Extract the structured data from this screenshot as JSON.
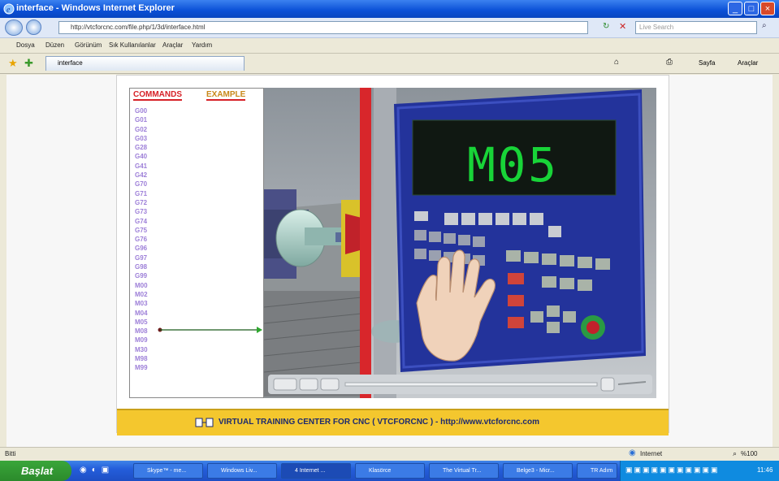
{
  "window": {
    "title": "interface - Windows Internet Explorer"
  },
  "address": {
    "url": "http://vtcforcnc.com/file.php/1/3d/interface.html",
    "search_placeholder": "Live Search"
  },
  "menu": [
    "Dosya",
    "Düzen",
    "Görünüm",
    "Sık Kullanılanlar",
    "Araçlar",
    "Yardım"
  ],
  "tab": {
    "label": "interface"
  },
  "toolbar_right": {
    "page_label": "Sayfa",
    "tools_label": "Araçlar"
  },
  "commands": {
    "tab_commands": "COMMANDS",
    "tab_example": "EXAMPLE",
    "items": [
      "G00",
      "G01",
      "G02",
      "G03",
      "G28",
      "G40",
      "G41",
      "G42",
      "G70",
      "G71",
      "G72",
      "G73",
      "G74",
      "G75",
      "G76",
      "G96",
      "G97",
      "G98",
      "G99",
      "M00",
      "M02",
      "M03",
      "M04",
      "M05",
      "M08",
      "M09",
      "M30",
      "M98",
      "M99"
    ]
  },
  "display": {
    "text": "M05"
  },
  "banner": {
    "text": "VIRTUAL TRAINING CENTER FOR CNC ( VTCFORCNC ) - http://www.vtcforcnc.com"
  },
  "status": {
    "left": "Bitti",
    "zone": "Internet",
    "zoom": "%100"
  },
  "taskbar": {
    "start": "Başlat",
    "buttons": [
      "Skype™ - me...",
      "Windows Liv...",
      "4 Internet ...",
      "Klasörce",
      "The Virtual Tr...",
      "Belge3 - Micr...",
      "TR Adım"
    ],
    "clock": "11:46"
  },
  "colors": {
    "accent_red": "#e0262b",
    "display_green": "#18d438",
    "banner": "#f4c72e"
  }
}
